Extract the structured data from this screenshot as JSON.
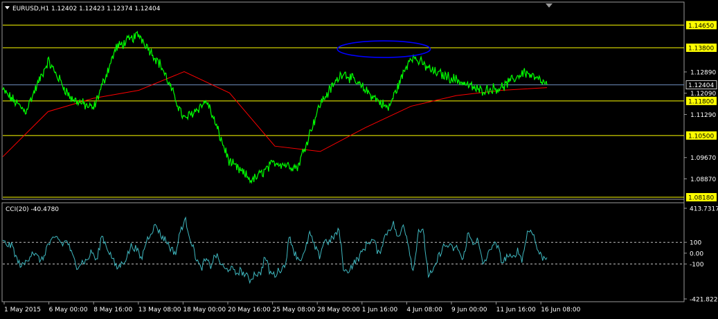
{
  "main": {
    "symbol_line": "EURUSD,H1  1.12402 1.12423 1.12374 1.12404"
  },
  "indicator": {
    "label": "CCI(20) -40.4780"
  },
  "colors": {
    "background": "#000000",
    "price": "#00ff00",
    "moving_average": "#ff0000",
    "horizontal_level": "#ffff00",
    "current_price_line": "#6f8fbf",
    "cci": "#3fb8c0",
    "annotation_ellipse": "#0000ff",
    "level_badge": "#ffff00",
    "axis_text": "#ffffff"
  },
  "chart_data": [
    {
      "type": "line",
      "symbol": "EURUSD",
      "timeframe": "H1",
      "title": "EURUSD,H1  1.12402 1.12423 1.12374 1.12404",
      "ylim": [
        1.0818,
        1.151
      ],
      "y_ticks": [
        "1.14650",
        "1.13800",
        "1.12890",
        "1.12404",
        "1.12090",
        "1.11800",
        "1.11290",
        "1.10500",
        "1.09670",
        "1.08870",
        "1.08180"
      ],
      "x_ticks": [
        "1 May 2015",
        "6 May 00:00",
        "8 May 16:00",
        "13 May 08:00",
        "18 May 00:00",
        "20 May 16:00",
        "25 May 08:00",
        "28 May 00:00",
        "1 Jun 16:00",
        "4 Jun 08:00",
        "9 Jun 00:00",
        "11 Jun 16:00",
        "16 Jun 08:00"
      ],
      "horizontal_levels": [
        1.1465,
        1.138,
        1.118,
        1.105,
        1.0818
      ],
      "current_price": 1.12404,
      "series": [
        {
          "role": "price",
          "x": [
            "1 May 2015",
            "4 May",
            "6 May",
            "8 May",
            "11 May",
            "13 May",
            "15 May",
            "18 May",
            "20 May",
            "21 May",
            "25 May",
            "27 May",
            "28 May",
            "1 Jun",
            "2 Jun",
            "4 Jun",
            "5 Jun",
            "8 Jun",
            "9 Jun",
            "10 Jun",
            "11 Jun",
            "12 Jun",
            "15 Jun",
            "16 Jun",
            "17 Jun"
          ],
          "values": [
            1.122,
            1.114,
            1.133,
            1.119,
            1.115,
            1.138,
            1.143,
            1.131,
            1.111,
            1.118,
            1.095,
            1.088,
            1.095,
            1.093,
            1.117,
            1.129,
            1.122,
            1.115,
            1.135,
            1.129,
            1.126,
            1.122,
            1.123,
            1.129,
            1.124
          ]
        },
        {
          "role": "moving_average",
          "x": [
            "1 May 2015",
            "6 May",
            "11 May",
            "15 May",
            "18 May",
            "21 May",
            "27 May",
            "1 Jun",
            "4 Jun",
            "9 Jun",
            "11 Jun",
            "16 Jun",
            "17 Jun"
          ],
          "values": [
            1.097,
            1.114,
            1.119,
            1.122,
            1.129,
            1.121,
            1.101,
            1.099,
            1.108,
            1.116,
            1.12,
            1.122,
            1.123
          ]
        }
      ],
      "annotation": {
        "shape": "ellipse",
        "x_range": [
          "4 Jun",
          "9 Jun"
        ],
        "y_range": [
          1.137,
          1.14
        ]
      }
    },
    {
      "type": "line",
      "title": "CCI(20) -40.4780",
      "ylim": [
        -421.8225,
        413.7317
      ],
      "y_ticks": [
        "413.7317",
        "100",
        "0.00",
        "-100",
        "-421.8225"
      ],
      "reference_levels": [
        100,
        -100
      ],
      "current_value": -40.478,
      "series": [
        {
          "role": "cci",
          "values": [
            100,
            80,
            60,
            -80,
            -120,
            -60,
            20,
            -40,
            -70,
            70,
            110,
            150,
            80,
            120,
            -20,
            -120,
            -80,
            -70,
            20,
            -80,
            170,
            60,
            -30,
            -140,
            -100,
            -40,
            70,
            40,
            -60,
            110,
            200,
            260,
            160,
            120,
            40,
            0,
            230,
            300,
            120,
            -30,
            -150,
            -60,
            -120,
            -10,
            -90,
            -160,
            -130,
            -190,
            -160,
            -200,
            -250,
            -180,
            -200,
            -30,
            -180,
            -200,
            -150,
            -120,
            160,
            0,
            -60,
            -10,
            190,
            60,
            -30,
            120,
            100,
            160,
            210,
            -180,
            -150,
            -90,
            -40,
            40,
            110,
            120,
            -20,
            130,
            220,
            270,
            120,
            280,
            80,
            -180,
            220,
            190,
            -200,
            -180,
            -40,
            60,
            70,
            40,
            50,
            -80,
            180,
            100,
            120,
            -100,
            -30,
            90,
            60,
            -90,
            -20,
            -60,
            30,
            -60,
            190,
            220,
            40,
            -40,
            -40
          ]
        }
      ]
    }
  ]
}
